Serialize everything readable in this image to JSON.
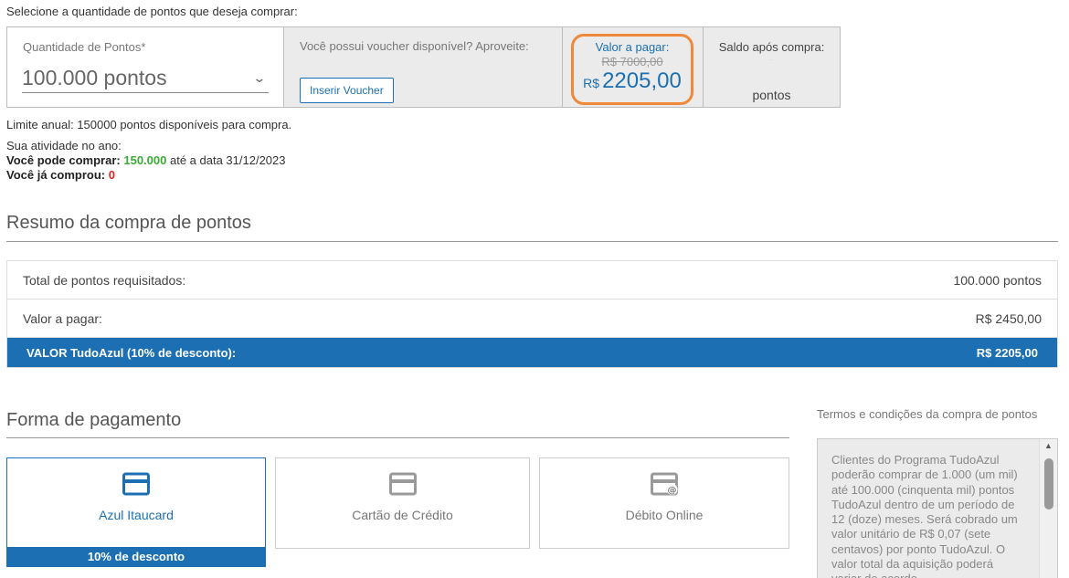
{
  "intro": "Selecione a quantidade de pontos que deseja comprar:",
  "selector": {
    "qty_label": "Quantidade de Pontos*",
    "qty_value": "100.000 pontos",
    "voucher_text": "Você possui voucher disponível? Aproveite:",
    "voucher_button": "Inserir Voucher",
    "price_label": "Valor a pagar:",
    "price_old": "R$ 7000,00",
    "price_currency": "R$",
    "price_new": "2205,00",
    "balance_label": "Saldo após compra:",
    "balance_value": "-",
    "balance_unit": "pontos"
  },
  "limit_text": "Limite anual: 150000 pontos disponíveis para compra.",
  "activity": {
    "heading": "Sua atividade no ano:",
    "can_buy_label": "Você pode comprar:",
    "can_buy_value": "150.000",
    "can_buy_suffix": "até a data 31/12/2023",
    "bought_label": "Você já comprou:",
    "bought_value": "0"
  },
  "summary": {
    "title": "Resumo da compra de pontos",
    "rows": [
      {
        "label": "Total de pontos requisitados:",
        "value": "100.000 pontos"
      },
      {
        "label": "Valor a pagar:",
        "value": "R$ 2450,00"
      }
    ],
    "total_label": "VALOR TudoAzul (10% de desconto):",
    "total_value": "R$ 2205,00"
  },
  "payment": {
    "title": "Forma de pagamento",
    "options": [
      {
        "label": "Azul Itaucard",
        "icon": "credit-card-icon",
        "discount": "10% de desconto"
      },
      {
        "label": "Cartão de Crédito",
        "icon": "credit-card-icon"
      },
      {
        "label": "Débito Online",
        "icon": "online-debit-icon"
      }
    ]
  },
  "terms": {
    "title": "Termos e condições da compra de pontos",
    "text": "Clientes do Programa TudoAzul poderão comprar de 1.000 (um mil) até 100.000 (cinquenta mil) pontos TudoAzul dentro de um período de 12 (doze) meses. Será cobrado um valor unitário de R$ 0,07 (sete centavos) por ponto TudoAzul. O valor total da aquisição poderá variar de acordo"
  },
  "colors": {
    "brand_blue": "#1c6fb2",
    "highlight_orange": "#f0883a",
    "success_green": "#3aa935",
    "alert_red": "#e3261f"
  }
}
